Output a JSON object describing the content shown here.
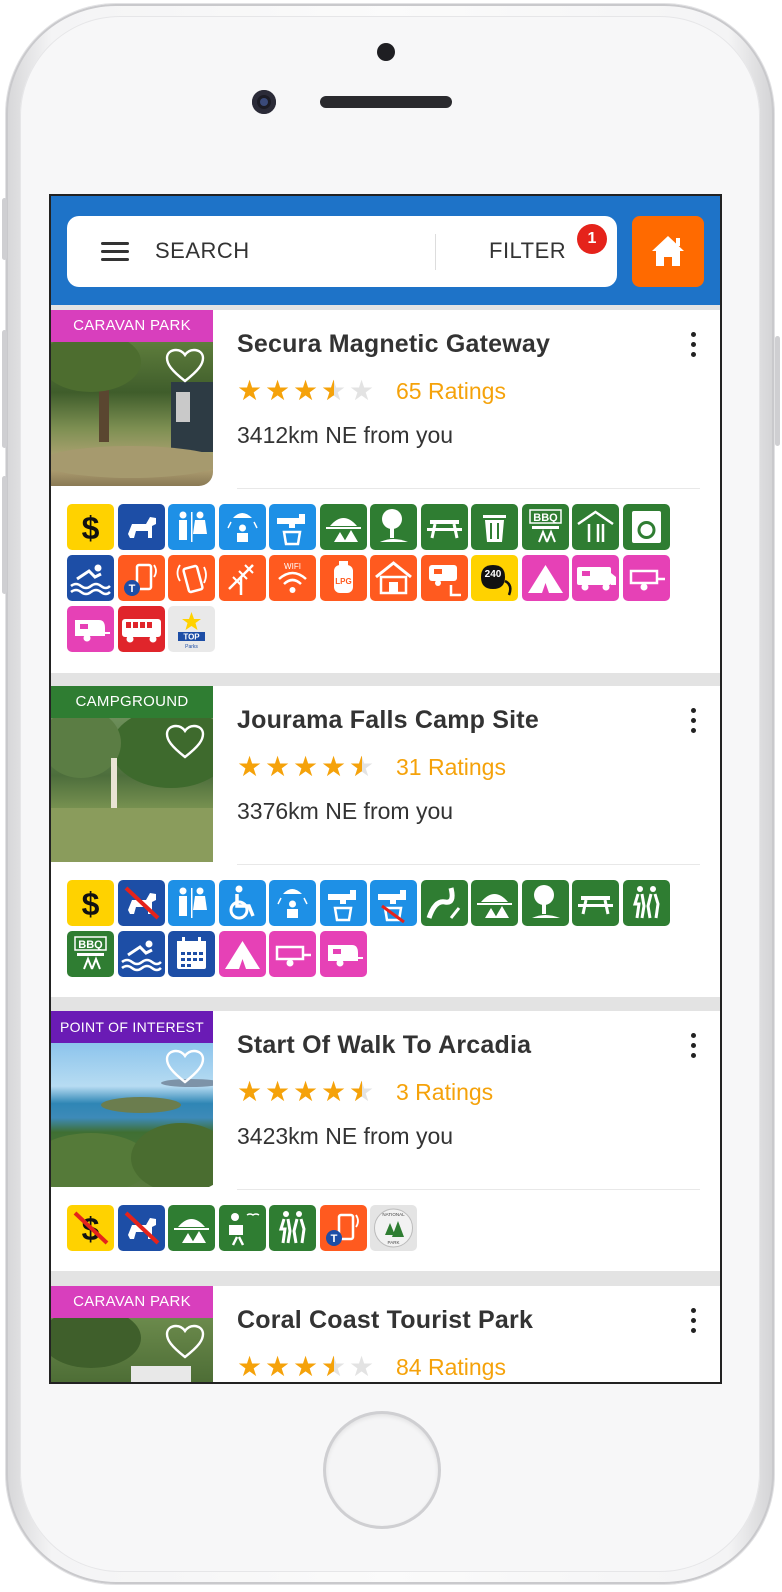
{
  "app": {
    "search_label": "SEARCH",
    "filter_label": "FILTER",
    "filter_count": "1",
    "accent_blue": "#1e73c8",
    "home_button_color": "#ff6a00"
  },
  "listings": [
    {
      "category": "CARAVAN PARK",
      "category_color": "#d83fbd",
      "title": "Secura Magnetic Gateway",
      "rating": 3.5,
      "ratings_label": "65 Ratings",
      "distance": "3412km NE from you",
      "amenities": [
        "dollar",
        "dog",
        "toilets",
        "shower",
        "tap",
        "viewpoint",
        "tree-walk",
        "picnic-table",
        "bin",
        "bbq",
        "camp-kitchen",
        "laundry",
        "swimming",
        "mobile-telstra",
        "mobile",
        "tv-antenna",
        "wifi",
        "lpg",
        "cabin",
        "caravan-dump",
        "power-240",
        "tent",
        "motorhome",
        "trailer",
        "caravan",
        "bus",
        "top-parks"
      ]
    },
    {
      "category": "CAMPGROUND",
      "category_color": "#2f7d32",
      "title": "Jourama Falls Camp Site",
      "rating": 4.5,
      "ratings_label": "31 Ratings",
      "distance": "3376km NE from you",
      "amenities": [
        "dollar",
        "no-dogs",
        "toilets",
        "wheelchair",
        "shower",
        "tap",
        "no-drinking-water",
        "waterfall",
        "viewpoint",
        "tree-walk",
        "picnic-table",
        "hiking",
        "bbq",
        "swimming",
        "calendar",
        "tent",
        "trailer",
        "caravan"
      ]
    },
    {
      "category": "POINT OF INTEREST",
      "category_color": "#6a1bb5",
      "title": "Start Of Walk To Arcadia",
      "rating": 4.5,
      "ratings_label": "3 Ratings",
      "distance": "3423km NE from you",
      "amenities": [
        "no-fee",
        "no-dogs",
        "viewpoint",
        "birdwatching",
        "hiking",
        "mobile-telstra",
        "national-park"
      ]
    },
    {
      "category": "CARAVAN PARK",
      "category_color": "#d83fbd",
      "title": "Coral Coast Tourist Park",
      "rating": 3.5,
      "ratings_label": "84 Ratings",
      "distance": "",
      "amenities": []
    }
  ]
}
